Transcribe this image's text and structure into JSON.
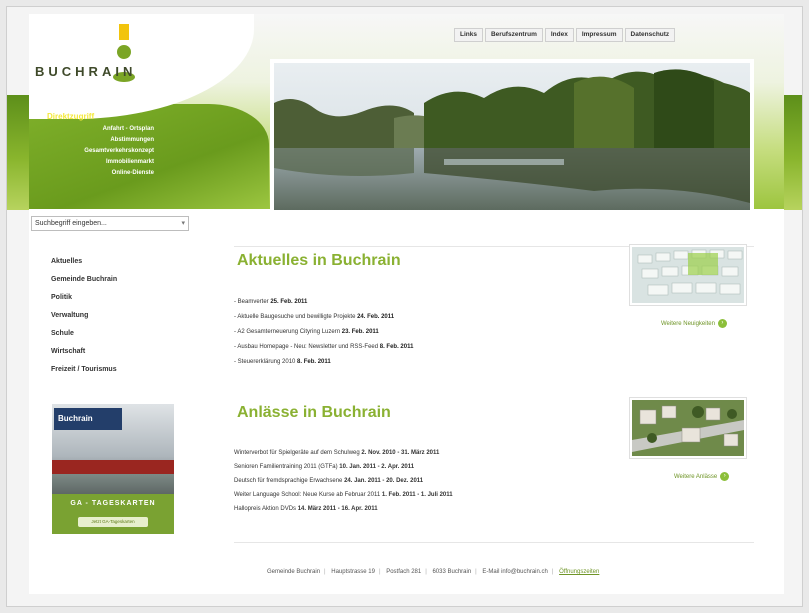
{
  "brand": {
    "logo_text": "BUCHRAIN"
  },
  "top_nav": [
    "Links",
    "Berufszentrum",
    "Index",
    "Impressum",
    "Datenschutz"
  ],
  "side_nav": {
    "heading": "Direktzugriff",
    "items": [
      "Anfahrt - Ortsplan",
      "Abstimmungen",
      "Gesamtverkehrskonzept",
      "Immobilienmarkt",
      "Online-Dienste"
    ]
  },
  "search": {
    "placeholder": "Suchbegriff eingeben..."
  },
  "left_links": [
    "Aktuelles",
    "Gemeinde Buchrain",
    "Politik",
    "Verwaltung",
    "Schule",
    "Wirtschaft",
    "Freizeit / Tourismus"
  ],
  "promo": {
    "sign": "Buchrain",
    "title": "GA - TAGESKARTEN",
    "subtitle": "Jetzt GA-Tageskarten"
  },
  "news": {
    "title": "Aktuelles in Buchrain",
    "items": [
      {
        "text": "- Beamverter ",
        "date": "25. Feb. 2011"
      },
      {
        "text": "- Aktuelle Baugesuche und bewilligte Projekte ",
        "date": "24. Feb. 2011"
      },
      {
        "text": "- A2 Gesamterneuerung Cityring Luzern ",
        "date": "23. Feb. 2011"
      },
      {
        "text": "- Ausbau Homepage - Neu: Newsletter und RSS-Feed ",
        "date": "8. Feb. 2011"
      },
      {
        "text": "- Steuererklärung 2010 ",
        "date": "8. Feb. 2011"
      }
    ],
    "more": "Weitere Neuigkeiten"
  },
  "events": {
    "title": "Anlässe in Buchrain",
    "items": [
      {
        "text": "Winterverbot für Spielgeräte auf dem Schulweg ",
        "date": "2. Nov. 2010 - 31. März 2011"
      },
      {
        "text": "Senioren Familientraining 2011 (GTFa) ",
        "date": "10. Jan. 2011 - 2. Apr. 2011"
      },
      {
        "text": "Deutsch für fremdsprachige Erwachsene ",
        "date": "24. Jan. 2011 - 20. Dez. 2011"
      },
      {
        "text": "Weiter Language School: Neue Kurse ab Februar 2011 ",
        "date": "1. Feb. 2011 - 1. Juli 2011"
      },
      {
        "text": "Hallopreis Aktion DVDs ",
        "date": "14. März 2011 - 16. Apr. 2011"
      }
    ],
    "more": "Weitere Anlässe"
  },
  "footer": {
    "items": [
      "Gemeinde Buchrain",
      "Hauptstrasse 19",
      "Postfach 281",
      "6033 Buchrain",
      "E-Mail info@buchrain.ch"
    ],
    "hours": "Öffnungszeiten"
  }
}
